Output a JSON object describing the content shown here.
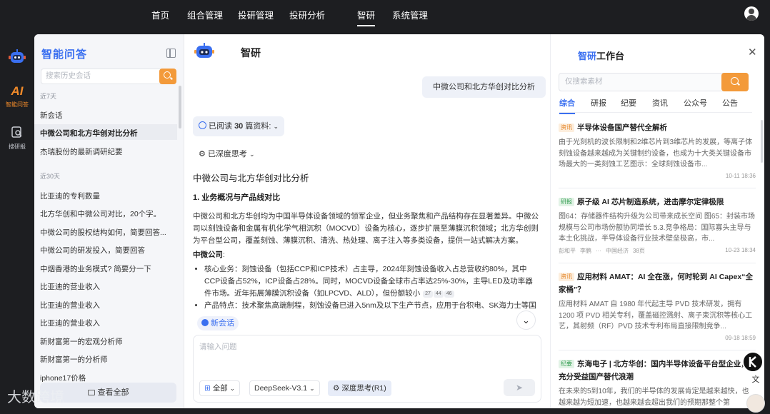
{
  "topnav": {
    "items": [
      {
        "label": "首页",
        "active": false
      },
      {
        "label": "组合管理",
        "active": false
      },
      {
        "label": "投研管理",
        "active": false
      },
      {
        "label": "投研分析",
        "active": false
      },
      {
        "label": "智研",
        "active": true
      },
      {
        "label": "系统管理",
        "active": false
      }
    ]
  },
  "rail": {
    "ai_icon_text": "AI",
    "items": [
      {
        "label": "智能问答",
        "active": true
      },
      {
        "label": "搜研报",
        "active": false
      }
    ]
  },
  "history": {
    "brand": "智能问答",
    "search_placeholder": "搜索历史会话",
    "group_recent": "近7天",
    "recent": [
      "新会话",
      "中微公司和北方华创对比分析",
      "杰瑞股份的最新调研纪要"
    ],
    "group_month": "近30天",
    "month": [
      "比亚迪的专利数量",
      "北方华创和中微公司对比，20个字。",
      "中微公司的股权结构如何，简要回答...",
      "中微公司的研发投入，简要回答",
      "中烟香港的业务模式? 简要分一下",
      "比亚迪的营业收入",
      "比亚迪的营业收入",
      "比亚迪的营业收入",
      "新财富第一的宏观分析师",
      "新财富第一的分析师",
      "iphone17价格"
    ],
    "view_all": "查看全部"
  },
  "chat": {
    "title": "智研",
    "user_message": "中微公司和北方华创对比分析",
    "read_label": "已阅读",
    "read_count": "30",
    "read_suffix": "篇资料:",
    "deep_label": "已深度思考",
    "answer_title": "中微公司与北方华创对比分析",
    "section1": "1. 业务概况与产品线对比",
    "para1": "中微公司和北方华创均为中国半导体设备领域的领军企业，但业务聚焦和产品结构存在显著差异。中微公司以刻蚀设备和金属有机化学气相沉积（MOCVD）设备为核心，逐步扩展至薄膜沉积领域；北方华创则为平台型公司，覆盖刻蚀、薄膜沉积、清洗、热处理、离子注入等多类设备，提供一站式解决方案。",
    "sub1": "中微公司",
    "sub1_suffix": ":",
    "bullet1": "核心业务：刻蚀设备（包括CCP和ICP技术）占主导，2024年刻蚀设备收入占总营收约80%，其中CCP设备占52%，ICP设备占28%。同时，MOCVD设备全球市占率达25%-30%，主导LED及功率器件市场。近年拓展薄膜沉积设备（如LPCVD、ALD），但份额较小",
    "cites": [
      "27",
      "44",
      "46"
    ],
    "bullet2": "产品特点：技术聚焦高端制程，刻蚀设备已进入5nm及以下生产节点，应用于台积电、SK海力士等国际",
    "new_chat": "新会话",
    "input_placeholder": "请输入问题",
    "scope": "全部",
    "model": "DeepSeek-V3.1",
    "deep_toggle": "深度思考(R1)"
  },
  "workbench": {
    "title_a": "智研",
    "title_b": "工作台",
    "search_placeholder": "仅搜索素材",
    "tabs": [
      "综合",
      "研报",
      "纪要",
      "资讯",
      "公众号",
      "公告"
    ],
    "active_tab": "综合",
    "cards": [
      {
        "tag": "资讯",
        "title": "半导体设备国产替代全解析",
        "body": "由于光刻机的波长限制和2维芯片到3维芯片的发展，等离子体刻蚀设备越来越成为关键制约设备，也成为十大类关键设备市场最大的一类刻蚀工艺图示：全球刻蚀设备市...",
        "source": "",
        "date": "10-11 18:36",
        "tags": []
      },
      {
        "tag": "研报",
        "title": "原子级 AI 芯片制造系统，进击摩尔定律极限",
        "body": "图64：存储器件结构升级为公司带来成长空间 图65：封装市场规模与公司市场份额协同增长 5.3.竞争格局：国际寡头主导与本土化挑战，半导体设备行业技术壁垒极高，市...",
        "source": "",
        "date": "10-23 18:34",
        "tags": [
          "彭和平",
          "李鹏",
          "···",
          "中国经济",
          "38页"
        ]
      },
      {
        "tag": "资讯",
        "title": "应用材料 AMAT：AI 全在涨，何时轮到 AI Capex“全家桶”？",
        "body": "应用材料 AMAT 自 1980 年代起主导 PVD 技术研发，拥有 1200 项 PVD 相关专利，覆盖磁控溅射、离子束沉积等核心工艺，其射频（RF）PVD 技术专利布局直接限制竞争...",
        "source": "",
        "date": "09-18 18:59",
        "tags": []
      },
      {
        "tag": "纪要",
        "title": "东海电子 | 北方华创：国内半导体设备平台型企业，充分受益国产替代浪潮",
        "body": "在未来的5到10年，我们的半导体的发展肯定是越来越快，也越来越为短加速，也越来越会超出我们的预期那整个第",
        "source": "",
        "date": "",
        "tags": []
      }
    ]
  },
  "watermark": "大数跨境"
}
